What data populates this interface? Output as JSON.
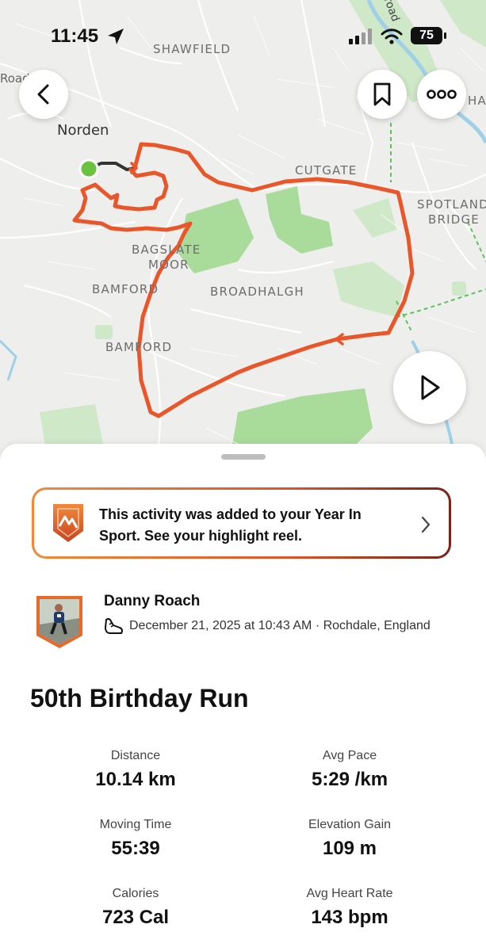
{
  "status_bar": {
    "time": "11:45",
    "battery": "75"
  },
  "map": {
    "places": [
      "SHAWFIELD",
      "Norden",
      "CUTGATE",
      "SPOTLAND",
      "BRIDGE",
      "BAGSLATE",
      "MOOR",
      "BAMFORD",
      "BROADHALGH",
      "BAMFORD",
      "Road",
      "HAW",
      "road"
    ],
    "route_color": "#e8562a",
    "start_color": "#6ac23f"
  },
  "banner": {
    "text": "This activity was added to your Year In Sport. See your highlight reel."
  },
  "athlete": {
    "name": "Danny Roach",
    "meta": "December 21, 2025 at 10:43 AM · Rochdale, England"
  },
  "activity": {
    "title": "50th Birthday Run"
  },
  "stats": [
    {
      "label": "Distance",
      "value": "10.14 km"
    },
    {
      "label": "Avg Pace",
      "value": "5:29 /km"
    },
    {
      "label": "Moving Time",
      "value": "55:39"
    },
    {
      "label": "Elevation Gain",
      "value": "109 m"
    },
    {
      "label": "Calories",
      "value": "723 Cal"
    },
    {
      "label": "Avg Heart Rate",
      "value": "143 bpm"
    }
  ],
  "icons": [
    "back-arrow-icon",
    "bookmark-icon",
    "more-options-icon",
    "play-icon",
    "year-in-sport-icon",
    "shoe-icon",
    "chevron-right-icon",
    "location-arrow-icon",
    "wifi-icon",
    "signal-icon",
    "battery-icon"
  ]
}
